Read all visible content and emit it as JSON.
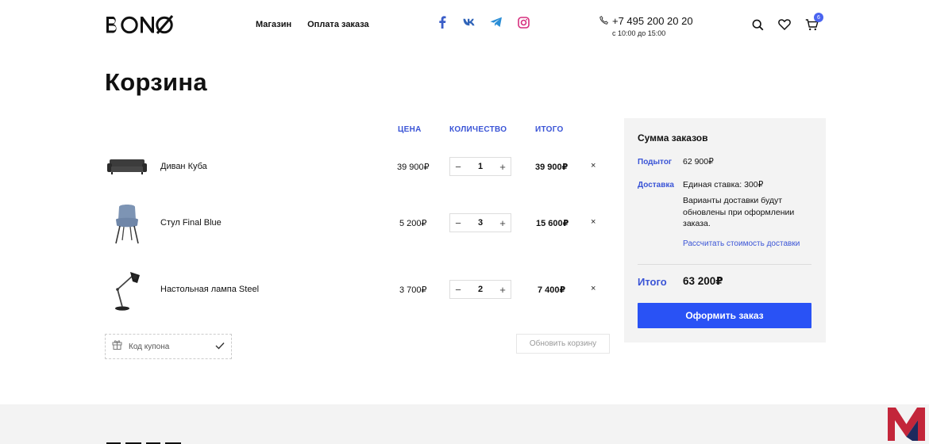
{
  "header": {
    "logo": "BONO",
    "nav": [
      "Магазин",
      "Оплата заказа"
    ],
    "social_icons": [
      "facebook-icon",
      "vk-icon",
      "telegram-icon",
      "instagram-icon"
    ],
    "phone": "+7 495 200 20 20",
    "hours": "с 10:00 до 15:00",
    "cart_count": "6",
    "icons": [
      "search-icon",
      "heart-icon",
      "cart-icon"
    ]
  },
  "page_title": "Корзина",
  "table": {
    "columns": {
      "price": "ЦЕНА",
      "quantity": "КОЛИЧЕСТВО",
      "total": "ИТОГО"
    },
    "rows": [
      {
        "name": "Диван Куба",
        "price": "39 900₽",
        "qty": "1",
        "total": "39 900₽",
        "thumb": "sofa-image"
      },
      {
        "name": "Стул Final Blue",
        "price": "5 200₽",
        "qty": "3",
        "total": "15 600₽",
        "thumb": "chair-image"
      },
      {
        "name": "Настольная лампа Steel",
        "price": "3 700₽",
        "qty": "2",
        "total": "7 400₽",
        "thumb": "lamp-image"
      }
    ],
    "remove_symbol": "×",
    "minus_symbol": "−",
    "plus_symbol": "+"
  },
  "coupon": {
    "placeholder": "Код купона"
  },
  "update_cart": "Обновить корзину",
  "summary": {
    "title": "Сумма заказов",
    "subtotal_label": "Подытог",
    "subtotal_value": "62 900₽",
    "delivery_label": "Доставка",
    "delivery_rate": "Единая ставка: 300₽",
    "delivery_note": "Варианты доставки будут обновлены при оформлении заказа.",
    "calc_link": "Рассчитать стоимость доставки",
    "total_label": "Итого",
    "total_value": "63 200₽",
    "checkout": "Оформить заказ"
  },
  "colors": {
    "accent": "#2952f5",
    "label_blue": "#3a54d6",
    "panel_bg": "#f3f3f3",
    "corner_logo_red": "#c3263a",
    "corner_logo_navy": "#1e2a5e"
  }
}
